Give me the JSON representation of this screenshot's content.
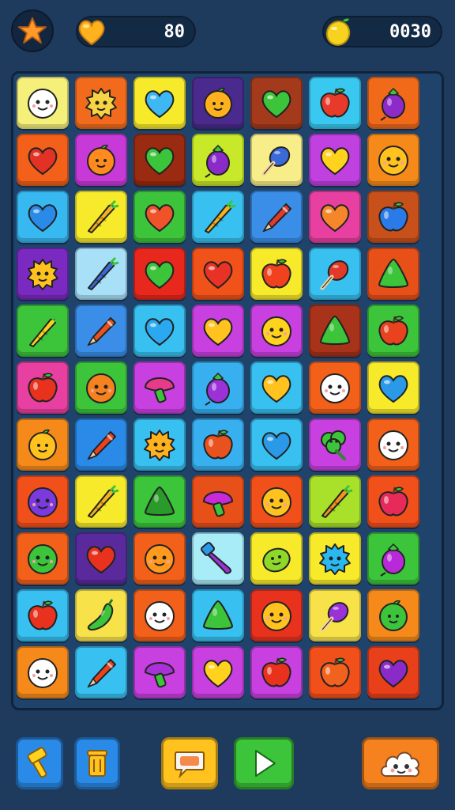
{
  "hud": {
    "moves_value": "80",
    "score_value": "0030",
    "moves_icon": "heart-coin-icon",
    "score_icon": "lemon-coin-icon",
    "menu_icon": "star-icon"
  },
  "board": {
    "rows": [
      [
        {
          "icon": "face",
          "bg": "#f5f07a",
          "c": "#ffffff"
        },
        {
          "icon": "fuzzy",
          "bg": "#f26b1c",
          "c": "#f7d443"
        },
        {
          "icon": "heart",
          "bg": "#f7ea2a",
          "c": "#3db8f2"
        },
        {
          "icon": "orange",
          "bg": "#4a2a8c",
          "c": "#ffb21e"
        },
        {
          "icon": "heart",
          "bg": "#a43a1c",
          "c": "#3cc43a"
        },
        {
          "icon": "apple",
          "bg": "#38c8f0",
          "c": "#e83a2a"
        },
        {
          "icon": "eggplant",
          "bg": "#f06a1a",
          "c": "#8e2ac8"
        }
      ],
      [
        {
          "icon": "heart",
          "bg": "#f2601a",
          "c": "#e23226"
        },
        {
          "icon": "orange",
          "bg": "#c73ad8",
          "c": "#ff8a1e"
        },
        {
          "icon": "heart",
          "bg": "#9a2a10",
          "c": "#3cc43a"
        },
        {
          "icon": "eggplant",
          "bg": "#c8e82a",
          "c": "#8a2ac8"
        },
        {
          "icon": "popsicle",
          "bg": "#f7ee8a",
          "c": "#3a6ad8"
        },
        {
          "icon": "heart",
          "bg": "#c040e0",
          "c": "#ffd21e"
        },
        {
          "icon": "face",
          "bg": "#f58a1a",
          "c": "#ffc21e"
        }
      ],
      [
        {
          "icon": "heart",
          "bg": "#38b8f0",
          "c": "#2a8ae8"
        },
        {
          "icon": "carrot",
          "bg": "#f7ea2a",
          "c": "#f5b21e"
        },
        {
          "icon": "heart",
          "bg": "#3cc43a",
          "c": "#f0522a"
        },
        {
          "icon": "carrot",
          "bg": "#38c0f0",
          "c": "#f5b21e"
        },
        {
          "icon": "crayon",
          "bg": "#3a8ee8",
          "c": "#e23a2a"
        },
        {
          "icon": "heart",
          "bg": "#e840a0",
          "c": "#f5862a"
        },
        {
          "icon": "apple",
          "bg": "#c8501a",
          "c": "#2a7ae8"
        }
      ],
      [
        {
          "icon": "fuzzy",
          "bg": "#7a2ac0",
          "c": "#ffc21e"
        },
        {
          "icon": "carrot",
          "bg": "#a8e0f8",
          "c": "#3a6ad8"
        },
        {
          "icon": "heart",
          "bg": "#e8281c",
          "c": "#3cc43a"
        },
        {
          "icon": "heart",
          "bg": "#f0521a",
          "c": "#e83226"
        },
        {
          "icon": "apple",
          "bg": "#f7ea2a",
          "c": "#f0421e"
        },
        {
          "icon": "popsicle",
          "bg": "#38c0f0",
          "c": "#e23a2a"
        },
        {
          "icon": "slime",
          "bg": "#e8501a",
          "c": "#3cc43a"
        }
      ],
      [
        {
          "icon": "carrot",
          "bg": "#3cc43a",
          "c": "#f7d21e"
        },
        {
          "icon": "crayon",
          "bg": "#3a8ee8",
          "c": "#e8521e"
        },
        {
          "icon": "heart",
          "bg": "#38c0f0",
          "c": "#2aa8f0"
        },
        {
          "icon": "heart",
          "bg": "#c840e0",
          "c": "#ffc21e"
        },
        {
          "icon": "face",
          "bg": "#c840e0",
          "c": "#ffd21e"
        },
        {
          "icon": "slime",
          "bg": "#a8321a",
          "c": "#3cc43a"
        },
        {
          "icon": "apple",
          "bg": "#3cc43a",
          "c": "#e8421e"
        }
      ],
      [
        {
          "icon": "apple",
          "bg": "#e840a0",
          "c": "#e8321e"
        },
        {
          "icon": "face",
          "bg": "#3cc43a",
          "c": "#f5821e"
        },
        {
          "icon": "mushroom",
          "bg": "#c840e0",
          "c": "#e83a8a"
        },
        {
          "icon": "eggplant",
          "bg": "#38b0f0",
          "c": "#9a32d8"
        },
        {
          "icon": "heart",
          "bg": "#38c0f0",
          "c": "#ffc21e"
        },
        {
          "icon": "face",
          "bg": "#f2601a",
          "c": "#ffffff"
        },
        {
          "icon": "heart",
          "bg": "#f7ea2a",
          "c": "#2a9ae8"
        }
      ],
      [
        {
          "icon": "orange",
          "bg": "#f58a1a",
          "c": "#ffc21e"
        },
        {
          "icon": "crayon",
          "bg": "#2a8ae8",
          "c": "#e8421e"
        },
        {
          "icon": "fuzzy",
          "bg": "#38c0f0",
          "c": "#ffb21e"
        },
        {
          "icon": "apple",
          "bg": "#38b0f0",
          "c": "#e8521e"
        },
        {
          "icon": "heart",
          "bg": "#38c0f0",
          "c": "#2a9ae8"
        },
        {
          "icon": "broccoli",
          "bg": "#c840e0",
          "c": "#3cc43a"
        },
        {
          "icon": "face",
          "bg": "#f2601a",
          "c": "#ffffff"
        }
      ],
      [
        {
          "icon": "face",
          "bg": "#f2501a",
          "c": "#7a3ae0"
        },
        {
          "icon": "carrot",
          "bg": "#f7ea2a",
          "c": "#f5b21e"
        },
        {
          "icon": "slime",
          "bg": "#3cc43a",
          "c": "#2a9a2a"
        },
        {
          "icon": "mushroom",
          "bg": "#e8501a",
          "c": "#c82ad8"
        },
        {
          "icon": "face",
          "bg": "#f2501a",
          "c": "#ffc21e"
        },
        {
          "icon": "carrot",
          "bg": "#a8e02a",
          "c": "#f5921e"
        },
        {
          "icon": "apple",
          "bg": "#f2501a",
          "c": "#e82a5a"
        }
      ],
      [
        {
          "icon": "face",
          "bg": "#f2601a",
          "c": "#3cc43a"
        },
        {
          "icon": "heart",
          "bg": "#5a2a9c",
          "c": "#e8321e"
        },
        {
          "icon": "face",
          "bg": "#f2601a",
          "c": "#ff9a1e"
        },
        {
          "icon": "cone",
          "bg": "#a8ecf8",
          "c": "#9a32d8"
        },
        {
          "icon": "lemon",
          "bg": "#f7ea2a",
          "c": "#8ed82a"
        },
        {
          "icon": "fuzzy",
          "bg": "#f7ea2a",
          "c": "#2ab8f0"
        },
        {
          "icon": "eggplant",
          "bg": "#3cc43a",
          "c": "#b82ad8"
        }
      ],
      [
        {
          "icon": "apple",
          "bg": "#38c0f0",
          "c": "#e8321e"
        },
        {
          "icon": "pepper",
          "bg": "#f7e24a",
          "c": "#3cc43a"
        },
        {
          "icon": "face",
          "bg": "#f2601a",
          "c": "#ffffff"
        },
        {
          "icon": "slime",
          "bg": "#38c0f0",
          "c": "#3cc43a"
        },
        {
          "icon": "face",
          "bg": "#e8321e",
          "c": "#ffc21e"
        },
        {
          "icon": "popsicle",
          "bg": "#f7e24a",
          "c": "#9a32d8"
        },
        {
          "icon": "orange",
          "bg": "#f58a1a",
          "c": "#3cc43a"
        }
      ],
      [
        {
          "icon": "face",
          "bg": "#f58a1a",
          "c": "#ffffff"
        },
        {
          "icon": "crayon",
          "bg": "#38c0f0",
          "c": "#e8421e"
        },
        {
          "icon": "mushroom",
          "bg": "#c840e0",
          "c": "#a832d8"
        },
        {
          "icon": "heart",
          "bg": "#c840e0",
          "c": "#ffd21e"
        },
        {
          "icon": "apple",
          "bg": "#c840e0",
          "c": "#e8321e"
        },
        {
          "icon": "apple",
          "bg": "#f2501a",
          "c": "#f0621e"
        },
        {
          "icon": "heart",
          "bg": "#e8401a",
          "c": "#8a2ac8"
        }
      ]
    ]
  },
  "buttons": [
    {
      "name": "hammer-button",
      "icon": "hammer-icon",
      "bg": "#2a8ae8"
    },
    {
      "name": "trash-button",
      "icon": "trash-can-icon",
      "bg": "#2a8ae8"
    },
    {
      "name": "chat-button",
      "icon": "speech-bubble-icon",
      "bg": "#ffc21e"
    },
    {
      "name": "play-button",
      "icon": "play-icon",
      "bg": "#3cc43a"
    },
    {
      "name": "character-button",
      "icon": "cloud-face-icon",
      "bg": "#f5821e"
    }
  ]
}
